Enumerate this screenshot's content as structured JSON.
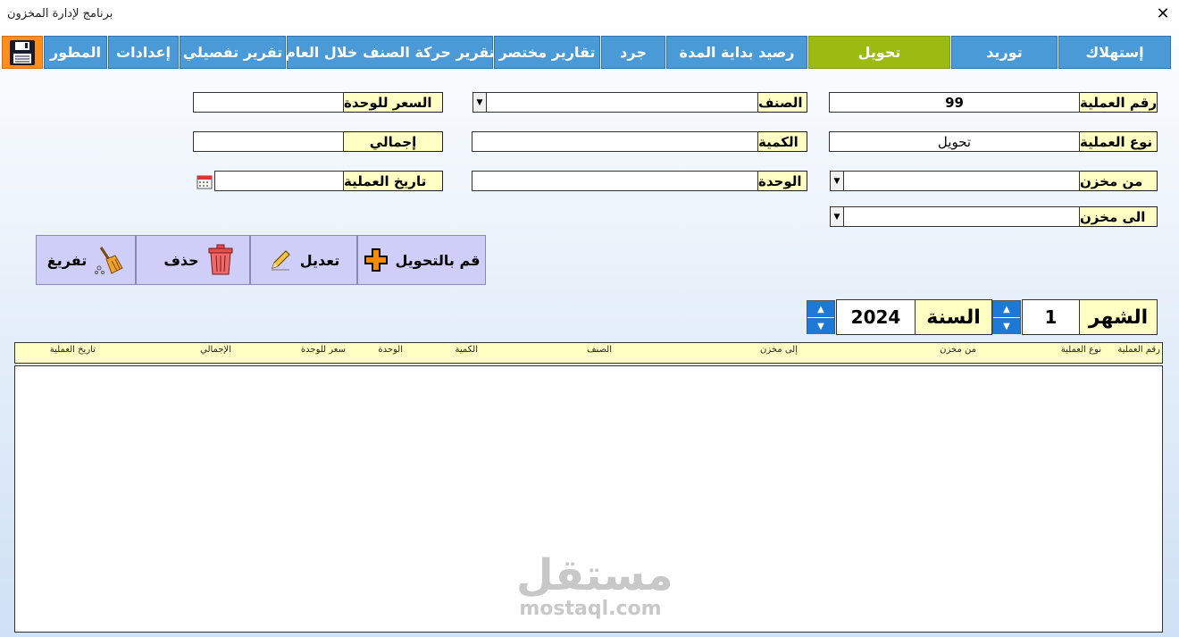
{
  "window": {
    "title": "برنامج لإدارة المخزون",
    "close_glyph": "✕"
  },
  "tabs": [
    {
      "label": "إستهلاك",
      "active": false
    },
    {
      "label": "توريد",
      "active": false
    },
    {
      "label": "تحويل",
      "active": true
    },
    {
      "label": "رصيد بداية المدة",
      "active": false
    },
    {
      "label": "جرد",
      "active": false
    },
    {
      "label": "تقارير مختصر",
      "active": false
    },
    {
      "label": "تقرير حركة الصنف خلال العام",
      "active": false
    },
    {
      "label": "تقرير تفصيلي",
      "active": false
    },
    {
      "label": "إعدادات",
      "active": false
    },
    {
      "label": "المطور",
      "active": false
    }
  ],
  "save_icon": "floppy-disk-icon",
  "form": {
    "op_number": {
      "label": "رقم العملية",
      "value": "99"
    },
    "op_type": {
      "label": "نوع العملية",
      "value": "تحويل"
    },
    "from_store": {
      "label": "من مخزن",
      "value": ""
    },
    "to_store": {
      "label": "الى مخزن",
      "value": ""
    },
    "item": {
      "label": "الصنف",
      "value": ""
    },
    "quantity": {
      "label": "الكمية",
      "value": ""
    },
    "unit": {
      "label": "الوحدة",
      "value": ""
    },
    "unit_price": {
      "label": "السعر للوحدة",
      "value": ""
    },
    "total": {
      "label": "إجمالي",
      "value": ""
    },
    "op_date": {
      "label": "تاريخ العملية",
      "value": ""
    }
  },
  "actions": {
    "transfer": "قم بالتحويل",
    "edit": "تعديل",
    "delete": "حذف",
    "clear": "تفريغ"
  },
  "period": {
    "month_label": "الشهر",
    "month_value": "1",
    "year_label": "السنة",
    "year_value": "2024"
  },
  "table": {
    "columns": [
      "رقم العملية",
      "نوع العملية",
      "من مخزن",
      "إلى مخزن",
      "الصنف",
      "الكمية",
      "الوحدة",
      "سعر للوحدة",
      "الإجمالي",
      "تاريخ العملية"
    ],
    "rows": []
  },
  "watermark": {
    "arabic": "مستقل",
    "latin": "mostaql.com"
  },
  "colors": {
    "tab_blue": "#4a9ad8",
    "tab_active_green": "#9bbb12",
    "save_orange": "#ff8e1f",
    "label_yellow": "#ffffc4",
    "action_lavender": "#cfcef8",
    "spin_blue": "#1d78d6"
  }
}
